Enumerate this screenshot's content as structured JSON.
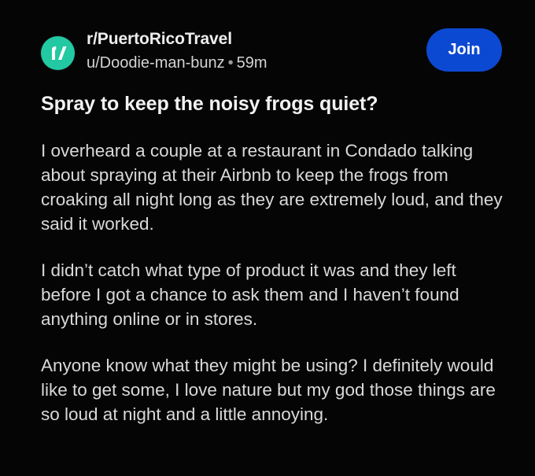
{
  "post": {
    "subreddit": "r/PuertoRicoTravel",
    "author": "u/Doodie-man-bunz",
    "separator": "•",
    "time_ago": "59m",
    "join_label": "Join",
    "title": "Spray to keep the noisy frogs quiet?",
    "paragraphs": [
      "I overheard a couple at a restaurant in Condado talking about spraying at their Airbnb to keep the frogs from croaking all night long as they are extremely loud, and they said it worked.",
      "I didn’t catch what type of product it was and they left before I got a chance to ask them and I haven’t found anything online or in stores.",
      "Anyone know what they might be using? I definitely would like to get some, I love nature but my god those things are so loud at night and a little annoying."
    ]
  },
  "icons": {
    "avatar": "subreddit-avatar-icon"
  },
  "colors": {
    "background": "#050505",
    "accent": "#0c49d3",
    "avatar": "#22c9a2",
    "text": "#d9d9d9",
    "title": "#f2f2f2"
  }
}
